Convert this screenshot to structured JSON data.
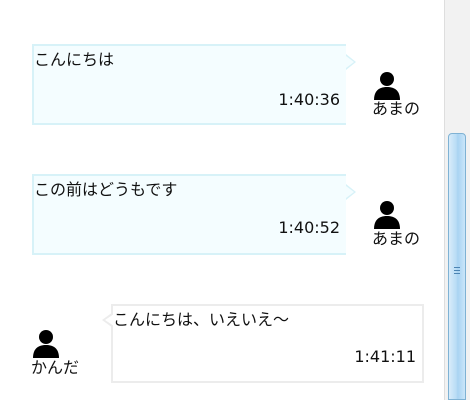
{
  "messages": [
    {
      "direction": "outgoing",
      "text": "こんにちは",
      "time": "1:40:36",
      "user": "あまの",
      "avatar_icon": "user-silhouette-icon"
    },
    {
      "direction": "outgoing",
      "text": "この前はどうもです",
      "time": "1:40:52",
      "user": "あまの",
      "avatar_icon": "user-silhouette-icon"
    },
    {
      "direction": "incoming",
      "text": "こんにちは、いえいえ〜",
      "time": "1:41:11",
      "user": "かんだ",
      "avatar_icon": "user-silhouette-icon"
    }
  ],
  "colors": {
    "outgoing_bubble_bg": "#f4fdff",
    "outgoing_bubble_border": "#d7f2f8",
    "incoming_bubble_border": "#ececec",
    "scroll_thumb": "#b9dcf5"
  }
}
